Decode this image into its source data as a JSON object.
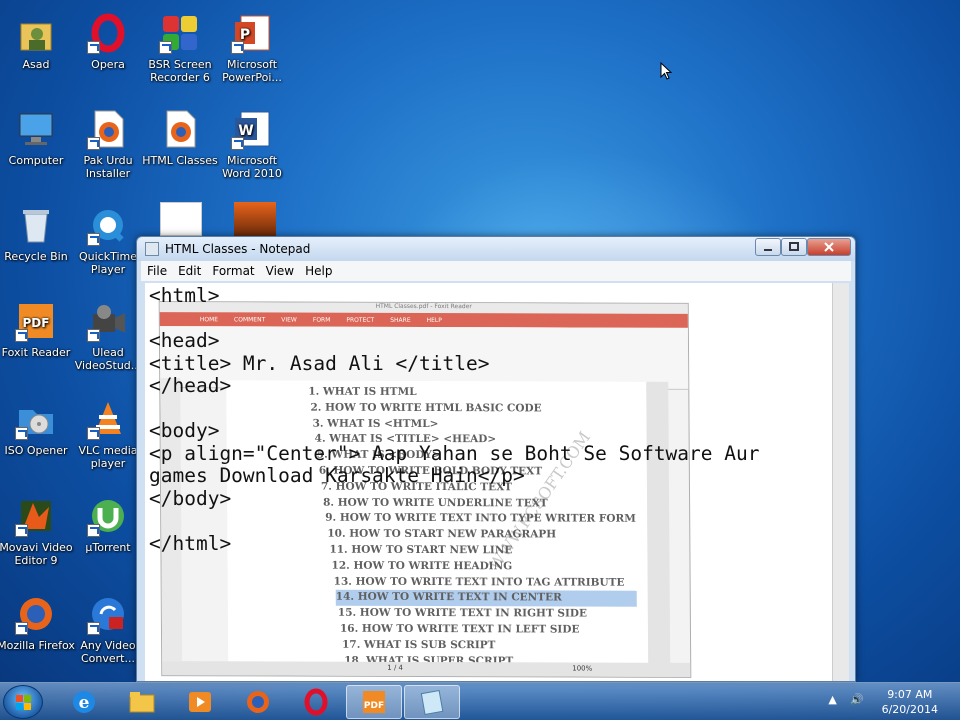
{
  "desktop": {
    "icons": [
      {
        "label": "Asad",
        "icon": "user-folder-icon"
      },
      {
        "label": "Opera",
        "icon": "opera-icon"
      },
      {
        "label": "BSR Screen Recorder 6",
        "icon": "bsr-recorder-icon"
      },
      {
        "label": "Microsoft PowerPoi...",
        "icon": "powerpoint-icon"
      },
      {
        "label": "Computer",
        "icon": "computer-icon"
      },
      {
        "label": "Pak Urdu Installer",
        "icon": "firefox-file-icon"
      },
      {
        "label": "HTML Classes",
        "icon": "firefox-file-icon"
      },
      {
        "label": "Microsoft Word 2010",
        "icon": "word-icon"
      },
      {
        "label": "Recycle Bin",
        "icon": "recycle-bin-icon"
      },
      {
        "label": "QuickTime Player",
        "icon": "quicktime-icon"
      },
      {
        "label": "Foxit Reader",
        "icon": "foxit-icon"
      },
      {
        "label": "Ulead VideoStud...",
        "icon": "ulead-icon"
      },
      {
        "label": "ISO Opener",
        "icon": "iso-opener-icon"
      },
      {
        "label": "VLC media player",
        "icon": "vlc-icon"
      },
      {
        "label": "Movavi Video Editor 9",
        "icon": "movavi-icon"
      },
      {
        "label": "µTorrent",
        "icon": "utorrent-icon"
      },
      {
        "label": "Mozilla Firefox",
        "icon": "firefox-icon"
      },
      {
        "label": "Any Video Convert...",
        "icon": "any-video-converter-icon"
      }
    ]
  },
  "notepad": {
    "title": "HTML Classes - Notepad",
    "menu": [
      "File",
      "Edit",
      "Format",
      "View",
      "Help"
    ],
    "content": "<html>\n\n<head>\n<title> Mr. Asad Ali </title>\n</head>\n\n<body>\n<p align=\"Center\"> Aap Yahan se Boht Se Software Aur\ngames Download Karsakte Hain</p>\n</body>\n\n</html>"
  },
  "foxit": {
    "title": "HTML Classes.pdf - Foxit Reader",
    "tabs": [
      "HOME",
      "COMMENT",
      "VIEW",
      "FORM",
      "PROTECT",
      "SHARE",
      "HELP"
    ],
    "page_indicator": "1 / 4",
    "zoom": "100%",
    "watermark": "WWW.PCSOFT.COM",
    "list": [
      "1. WHAT IS HTML",
      "2. HOW TO WRITE HTML BASIC CODE",
      "3. WHAT IS <HTML>",
      "4. WHAT IS <TITLE> <HEAD>",
      "5. WHAT IS <BODY>",
      "6. HOW TO WRITE BOLD BODY TEXT",
      "7. HOW TO WRITE ITALIC TEXT",
      "8. HOW TO WRITE UNDERLINE TEXT",
      "9. HOW TO WRITE TEXT INTO TYPE WRITER FORM",
      "10. HOW TO START NEW PARAGRAPH",
      "11. HOW TO START NEW LINE",
      "12. HOW TO WRITE HEADING",
      "13. HOW TO WRITE TEXT INTO TAG ATTRIBUTE",
      "14. HOW TO WRITE TEXT IN CENTER",
      "15. HOW TO WRITE TEXT IN RIGHT SIDE",
      "16. HOW TO WRITE TEXT IN LEFT SIDE",
      "17. WHAT IS SUB SCRIPT",
      "18. WHAT IS SUPER SCRIPT"
    ]
  },
  "taskbar": {
    "items": [
      "start-orb-icon",
      "internet-explorer-icon",
      "explorer-icon",
      "media-player-icon",
      "firefox-icon",
      "opera-icon",
      "foxit-icon",
      "notepad-icon"
    ],
    "time": "9:07 AM",
    "date": "6/20/2014"
  }
}
